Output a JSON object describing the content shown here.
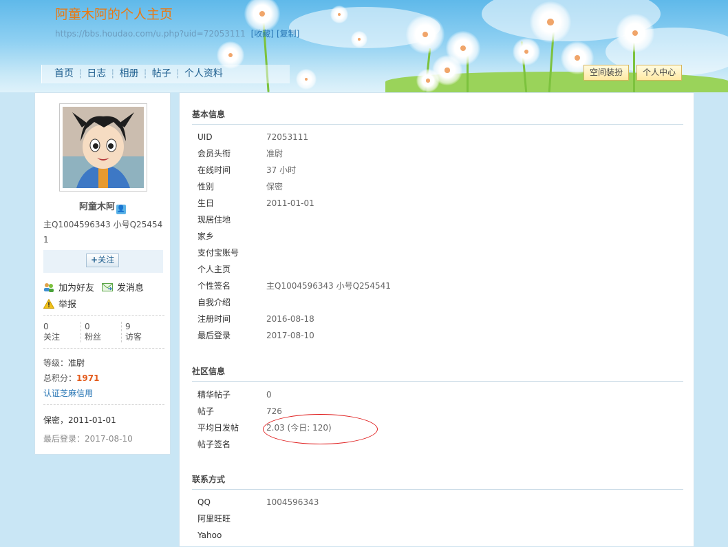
{
  "header": {
    "title": "阿童木阿的个人主页",
    "url": "https://bbs.houdao.com/u.php?uid=72053111",
    "favorite_link": "[收藏]",
    "copy_link": "[复制]",
    "nav": [
      "首页",
      "日志",
      "相册",
      "帖子",
      "个人资料"
    ],
    "decorate_button": "空间装扮",
    "center_button": "个人中心"
  },
  "profile": {
    "name": "阿童木阿",
    "signature": "主Q1004596343 小号Q254541",
    "follow_button": "关注",
    "add_friend": "加为好友",
    "send_message": "发消息",
    "report": "举报",
    "stats": [
      {
        "value": "0",
        "label": "关注"
      },
      {
        "value": "0",
        "label": "粉丝"
      },
      {
        "value": "9",
        "label": "访客"
      }
    ],
    "level_label": "等级：",
    "level_value": "准尉",
    "points_label": "总积分：",
    "points_value": "1971",
    "zhima_link": "认证芝麻信用",
    "gender_birthday": "保密，2011-01-01",
    "last_login": "最后登录：2017-08-10"
  },
  "basic_info": {
    "title": "基本信息",
    "rows": [
      {
        "k": "UID",
        "v": "72053111"
      },
      {
        "k": "会员头衔",
        "v": "准尉"
      },
      {
        "k": "在线时间",
        "v": "37 小时"
      },
      {
        "k": "性别",
        "v": "保密"
      },
      {
        "k": "生日",
        "v": "2011-01-01"
      },
      {
        "k": "现居住地",
        "v": ""
      },
      {
        "k": "家乡",
        "v": ""
      },
      {
        "k": "支付宝账号",
        "v": ""
      },
      {
        "k": "个人主页",
        "v": ""
      },
      {
        "k": "个性签名",
        "v": "主Q1004596343 小号Q254541"
      },
      {
        "k": "自我介绍",
        "v": ""
      },
      {
        "k": "注册时间",
        "v": "2016-08-18"
      },
      {
        "k": "最后登录",
        "v": "2017-08-10"
      }
    ]
  },
  "community_info": {
    "title": "社区信息",
    "rows": [
      {
        "k": "精华帖子",
        "v": "0"
      },
      {
        "k": "帖子",
        "v": "726"
      },
      {
        "k": "平均日发帖",
        "v": "2.03 (今日: 120)"
      },
      {
        "k": "帖子签名",
        "v": ""
      }
    ]
  },
  "contact_info": {
    "title": "联系方式",
    "rows": [
      {
        "k": "QQ",
        "v": "1004596343"
      },
      {
        "k": "阿里旺旺",
        "v": ""
      },
      {
        "k": "Yahoo",
        "v": ""
      }
    ]
  }
}
